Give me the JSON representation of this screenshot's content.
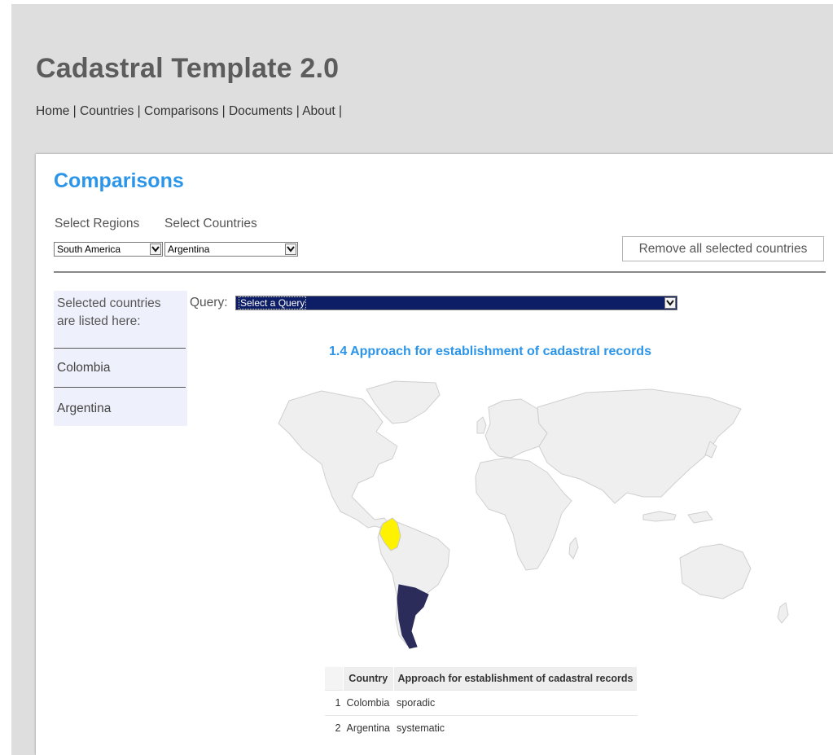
{
  "site": {
    "title": "Cadastral Template 2.0",
    "nav": [
      "Home",
      "Countries",
      "Comparisons",
      "Documents",
      "About"
    ],
    "nav_separator": "|"
  },
  "page": {
    "title": "Comparisons",
    "select_regions_label": "Select Regions",
    "select_countries_label": "Select Countries",
    "region_value": "South America",
    "country_value": "Argentina",
    "remove_button": "Remove all selected countries"
  },
  "sidebar": {
    "title_line1": "Selected countries",
    "title_line2": "are listed here:",
    "items": [
      "Colombia",
      "Argentina"
    ]
  },
  "query": {
    "label": "Query:",
    "value": "Select a Query"
  },
  "chart": {
    "title": "1.4 Approach for establishment of cadastral records"
  },
  "map_highlights": [
    {
      "country": "Colombia",
      "value": "sporadic",
      "color": "#fff200"
    },
    {
      "country": "Argentina",
      "value": "systematic",
      "color": "#2b2c5a"
    }
  ],
  "table": {
    "headers": [
      "Country",
      "Approach for establishment of cadastral records"
    ],
    "rows": [
      {
        "index": "1",
        "country": "Colombia",
        "approach": "sporadic"
      },
      {
        "index": "2",
        "country": "Argentina",
        "approach": "systematic"
      }
    ]
  },
  "colors": {
    "accent": "#2b95e9",
    "header_bg": "#dedede",
    "query_bg": "#0d1e66",
    "land": "#efefef"
  }
}
